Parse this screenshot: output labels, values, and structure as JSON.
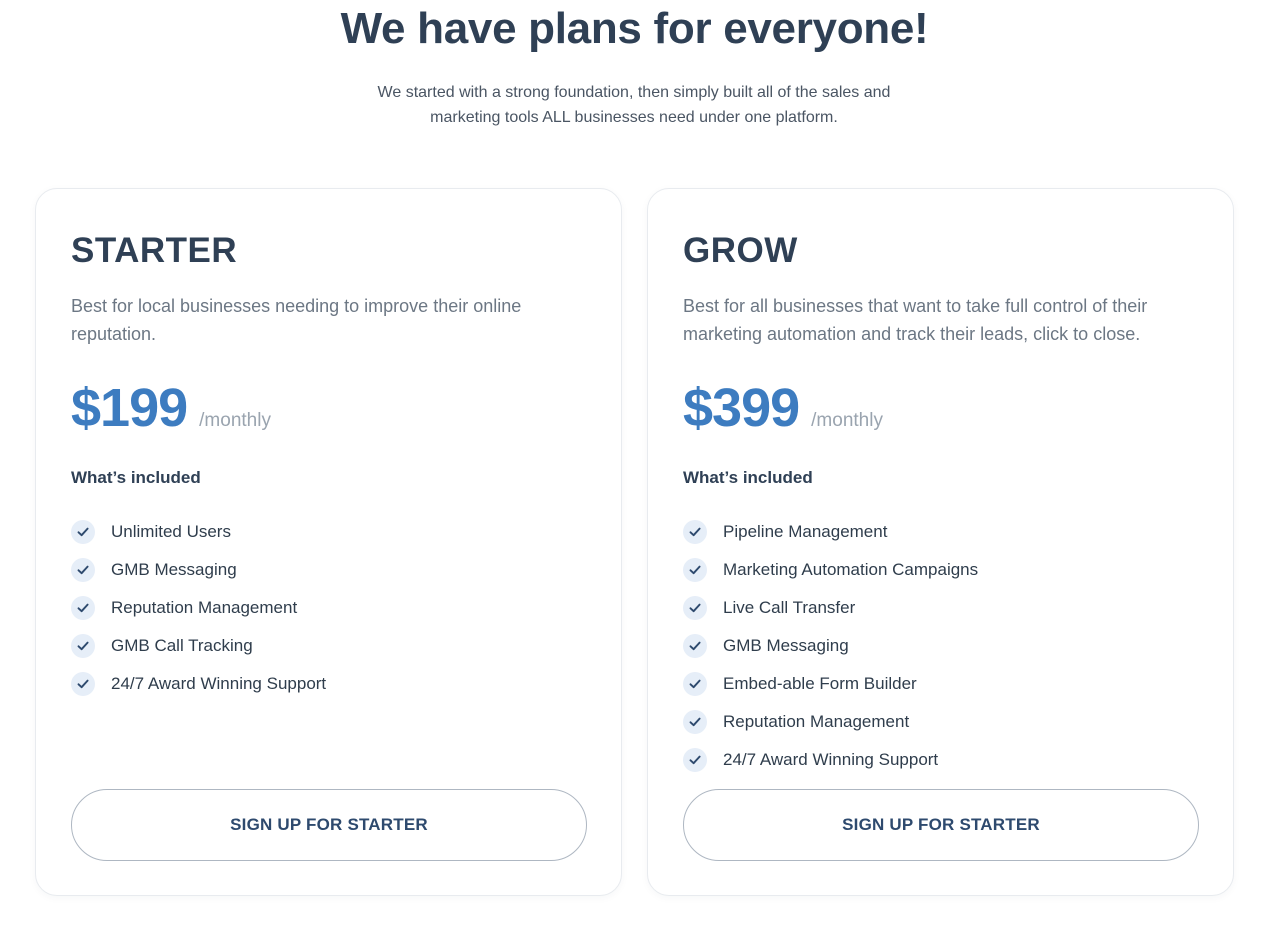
{
  "header": {
    "title": "We have plans for everyone!",
    "subtitle_line1": "We started with a strong foundation, then simply built all of the sales and",
    "subtitle_line2": "marketing tools ALL businesses need under one platform."
  },
  "plans": [
    {
      "name": "STARTER",
      "description": "Best for local businesses needing to improve their online reputation.",
      "price": "$199",
      "period": "/monthly",
      "included_label": "What’s included",
      "features": [
        "Unlimited Users",
        "GMB Messaging",
        "Reputation Management",
        "GMB Call Tracking",
        "24/7 Award Winning Support"
      ],
      "cta_label": "SIGN UP FOR STARTER"
    },
    {
      "name": "GROW",
      "description": "Best for all businesses that want to take full control of their marketing automation and track their leads, click to close.",
      "price": "$399",
      "period": "/monthly",
      "included_label": "What’s included",
      "features": [
        "Pipeline Management",
        "Marketing Automation Campaigns",
        "Live Call Transfer",
        "GMB Messaging",
        "Embed-able Form Builder",
        "Reputation Management",
        "24/7 Award Winning Support"
      ],
      "cta_label": "SIGN UP FOR STARTER"
    }
  ],
  "icons": {
    "feature_check": "check-icon"
  },
  "colors": {
    "price": "#3d7cc0",
    "heading": "#2f4055",
    "check_bg": "#e6eef8",
    "check_mark": "#2e4a6e"
  }
}
